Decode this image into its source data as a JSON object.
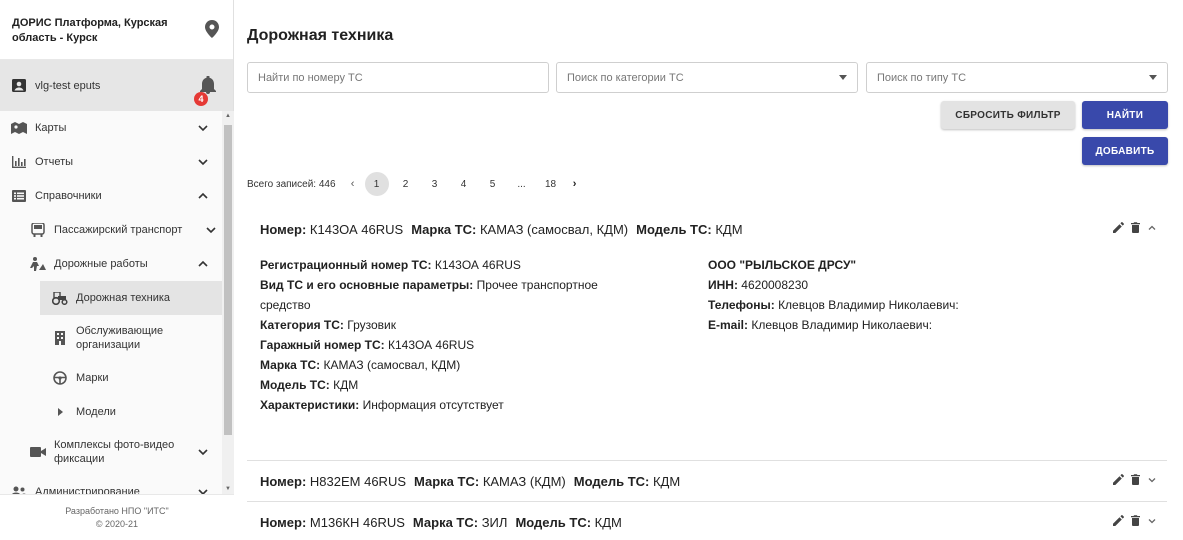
{
  "sidebar": {
    "org_title": "ДОРИС Платформа, Курская область - Курск",
    "user_name": "vlg-test eputs",
    "notifications_count": "4",
    "menu": [
      {
        "label": "Карты"
      },
      {
        "label": "Отчеты"
      },
      {
        "label": "Справочники"
      },
      {
        "label": "Пассажирский транспорт"
      },
      {
        "label": "Дорожные работы"
      },
      {
        "label": "Дорожная техника"
      },
      {
        "label": "Обслуживающие организации"
      },
      {
        "label": "Марки"
      },
      {
        "label": "Модели"
      },
      {
        "label": "Комплексы фото-видео фиксации"
      },
      {
        "label": "Администрирование"
      }
    ],
    "footer_line1": "Разработано НПО \"ИТС\"",
    "footer_line2": "© 2020-21"
  },
  "main": {
    "title": "Дорожная техника",
    "filters": {
      "number_placeholder": "Найти по номеру ТС",
      "category_placeholder": "Поиск по категории ТС",
      "type_placeholder": "Поиск по типу ТС"
    },
    "buttons": {
      "reset": "СБРОСИТЬ ФИЛЬТР",
      "find": "НАЙТИ",
      "add": "ДОБАВИТЬ"
    },
    "pagination": {
      "total": "Всего записей: 446",
      "prev": "‹",
      "pages": [
        "1",
        "2",
        "3",
        "4",
        "5"
      ],
      "ellipsis": "...",
      "last": "18",
      "next": "›",
      "current": "1"
    },
    "records": [
      {
        "number_label": "Номер:",
        "number": "К143ОА 46RUS",
        "brand_label": "Марка ТС:",
        "brand": "КАМАЗ (самосвал, КДМ)",
        "model_label": "Модель ТС:",
        "model": "КДМ",
        "expanded": true,
        "details": {
          "reg_label": "Регистрационный номер ТС:",
          "reg": "К143ОА 46RUS",
          "kind_label": "Вид ТС и его основные параметры:",
          "kind_line1": "Прочее транспортное",
          "kind_line2": "средство",
          "cat_label": "Категория ТС:",
          "cat": "Грузовик",
          "garage_label": "Гаражный номер ТС:",
          "garage": "К143ОА 46RUS",
          "brand_label": "Марка ТС:",
          "brand": "КАМАЗ (самосвал, КДМ)",
          "model_label": "Модель ТС:",
          "model": "КДМ",
          "chars_label": "Характеристики:",
          "chars": "Информация отсутствует",
          "org": "ООО \"РЫЛЬСКОЕ ДРСУ\"",
          "inn_label": "ИНН:",
          "inn": "4620008230",
          "phones_label": "Телефоны:",
          "phones": "Клевцов Владимир Николаевич:",
          "email_label": "E-mail:",
          "email": "Клевцов Владимир Николаевич:"
        }
      },
      {
        "number_label": "Номер:",
        "number": "Н832ЕМ 46RUS",
        "brand_label": "Марка ТС:",
        "brand": "КАМАЗ (КДМ)",
        "model_label": "Модель ТС:",
        "model": "КДМ",
        "expanded": false
      },
      {
        "number_label": "Номер:",
        "number": "М136КН 46RUS",
        "brand_label": "Марка ТС:",
        "brand": "ЗИЛ",
        "model_label": "Модель ТС:",
        "model": "КДМ",
        "expanded": false
      }
    ]
  }
}
